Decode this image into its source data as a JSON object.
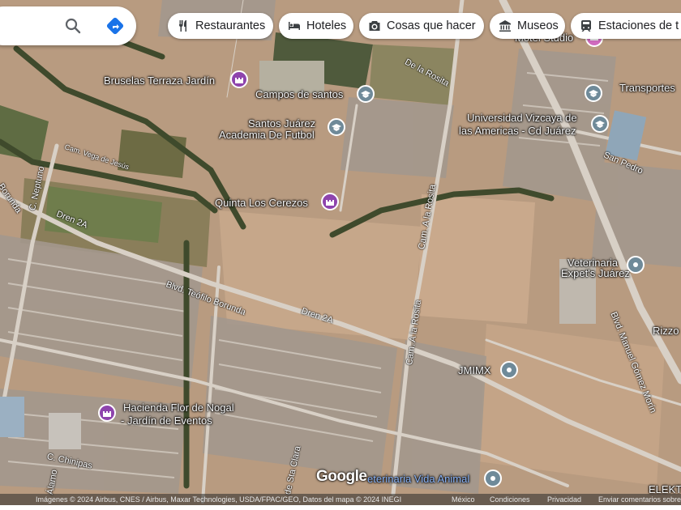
{
  "search": {
    "search_icon": "search-icon",
    "directions_icon": "directions-icon"
  },
  "chips": [
    {
      "label": "Restaurantes",
      "icon": "fork-knife-icon"
    },
    {
      "label": "Hoteles",
      "icon": "bed-icon"
    },
    {
      "label": "Cosas que hacer",
      "icon": "camera-icon"
    },
    {
      "label": "Museos",
      "icon": "museum-icon"
    },
    {
      "label": "Estaciones de t",
      "icon": "train-icon"
    }
  ],
  "places": {
    "bruselas": "Bruselas Terraza Jardín",
    "campos": "Campos de santos",
    "santos_1": "Santos Juárez",
    "santos_2": "Academia De Futbol",
    "universidad_1": "Universidad Vizcaya de",
    "universidad_2": "las Americas - Cd Juárez",
    "cerezos": "Quinta Los Cerezos",
    "veterinaria_1": "Veterinaria",
    "veterinaria_2": "Expet's Juárez",
    "jmimx": "JMIMX",
    "hacienda_1": "Hacienda Flor de Nogal",
    "hacienda_2": "- Jardín de Eventos",
    "vida_animal": "eterinaria Vida Animal",
    "transportes": "Transportes",
    "rizzo": "Rizzo",
    "motel": "Motel Studio",
    "elekt": "ELEKT"
  },
  "streets": {
    "neptuno": "C. Neptuno",
    "borunda": "Borunda",
    "dren_2a_w": "Dren 2A",
    "dren_2a_c": "Dren 2A",
    "teofilo": "Blvd. Teófilo Borunda",
    "rosita_1": "Cam. A la Rosita",
    "rosita_2": "Cam. A la Rosita",
    "rosita_ne": "De la Rosita",
    "san_pedro": "San Pedro",
    "gomez_morin": "Blvd. Manuel Gómez Morín",
    "chinipas": "C. Chinipas",
    "alamo": "Álamo",
    "sta_clara": "de Sta Clara",
    "cam_vega": "Cam. Vega de Jesús"
  },
  "attribution": {
    "text": "Imágenes © 2024 Airbus, CNES / Airbus, Maxar Technologies, USDA/FPAC/GEO, Datos del mapa © 2024 INEGI",
    "country": "México",
    "terms": "Condiciones",
    "privacy": "Privacidad",
    "feedback": "Enviar comentarios sobre el"
  },
  "logo": "Google",
  "colors": {
    "pin_purple": "#8e44ad",
    "pin_gray": "#6f8a99",
    "pin_pink": "#d06bbf",
    "directions_blue": "#1a73e8"
  }
}
